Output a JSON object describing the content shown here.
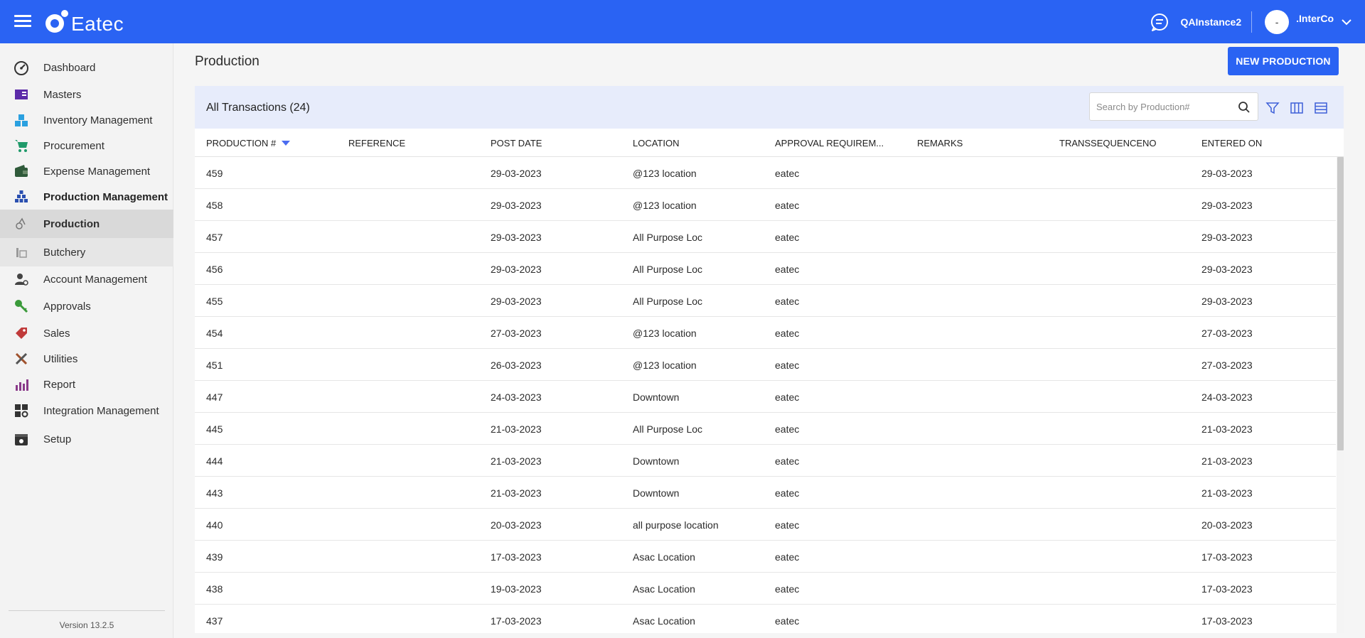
{
  "app": {
    "logo_text": "Eatec"
  },
  "header": {
    "instance": "QAInstance2",
    "avatar_text": "-",
    "user": ".InterCo"
  },
  "sidebar": {
    "items": [
      {
        "label": "Dashboard",
        "icon": "dashboard-icon"
      },
      {
        "label": "Masters",
        "icon": "masters-icon"
      },
      {
        "label": "Inventory Management",
        "icon": "inventory-icon"
      },
      {
        "label": "Procurement",
        "icon": "cart-icon"
      },
      {
        "label": "Expense Management",
        "icon": "wallet-icon"
      },
      {
        "label": "Production Management",
        "icon": "production-icon"
      },
      {
        "label": "Production",
        "icon": "production-sub-icon"
      },
      {
        "label": "Butchery",
        "icon": "butchery-icon"
      },
      {
        "label": "Account Management",
        "icon": "account-icon"
      },
      {
        "label": "Approvals",
        "icon": "key-icon"
      },
      {
        "label": "Sales",
        "icon": "tag-icon"
      },
      {
        "label": "Utilities",
        "icon": "tools-icon"
      },
      {
        "label": "Report",
        "icon": "report-icon"
      },
      {
        "label": "Integration Management",
        "icon": "integration-icon"
      },
      {
        "label": "Setup",
        "icon": "setup-icon"
      }
    ],
    "version": "Version 13.2.5"
  },
  "main": {
    "title": "Production",
    "new_button": "NEW PRODUCTION",
    "panel_title": "All Transactions (24)",
    "search_placeholder": "Search by Production#",
    "columns": [
      "PRODUCTION #",
      "REFERENCE",
      "POST DATE",
      "LOCATION",
      "APPROVAL REQUIREM...",
      "REMARKS",
      "TRANSSEQUENCENO",
      "ENTERED ON"
    ],
    "rows": [
      [
        "459",
        "",
        "29-03-2023",
        "@123 location",
        "eatec",
        "",
        "",
        "29-03-2023"
      ],
      [
        "458",
        "",
        "29-03-2023",
        "@123 location",
        "eatec",
        "",
        "",
        "29-03-2023"
      ],
      [
        "457",
        "",
        "29-03-2023",
        "All Purpose Loc",
        "eatec",
        "",
        "",
        "29-03-2023"
      ],
      [
        "456",
        "",
        "29-03-2023",
        "All Purpose Loc",
        "eatec",
        "",
        "",
        "29-03-2023"
      ],
      [
        "455",
        "",
        "29-03-2023",
        "All Purpose Loc",
        "eatec",
        "",
        "",
        "29-03-2023"
      ],
      [
        "454",
        "",
        "27-03-2023",
        "@123 location",
        "eatec",
        "",
        "",
        "27-03-2023"
      ],
      [
        "451",
        "",
        "26-03-2023",
        "@123 location",
        "eatec",
        "",
        "",
        "27-03-2023"
      ],
      [
        "447",
        "",
        "24-03-2023",
        "Downtown",
        "eatec",
        "",
        "",
        "24-03-2023"
      ],
      [
        "445",
        "",
        "21-03-2023",
        "All Purpose Loc",
        "eatec",
        "",
        "",
        "21-03-2023"
      ],
      [
        "444",
        "",
        "21-03-2023",
        "Downtown",
        "eatec",
        "",
        "",
        "21-03-2023"
      ],
      [
        "443",
        "",
        "21-03-2023",
        "Downtown",
        "eatec",
        "",
        "",
        "21-03-2023"
      ],
      [
        "440",
        "",
        "20-03-2023",
        "all purpose location",
        "eatec",
        "",
        "",
        "20-03-2023"
      ],
      [
        "439",
        "",
        "17-03-2023",
        "Asac Location",
        "eatec",
        "",
        "",
        "17-03-2023"
      ],
      [
        "438",
        "",
        "19-03-2023",
        "Asac Location",
        "eatec",
        "",
        "",
        "17-03-2023"
      ],
      [
        "437",
        "",
        "17-03-2023",
        "Asac Location",
        "eatec",
        "",
        "",
        "17-03-2023"
      ]
    ]
  },
  "colors": {
    "primary": "#2a63f3",
    "panel_header": "#e7ecfb",
    "sort_indicator": "#4b6cf0"
  }
}
